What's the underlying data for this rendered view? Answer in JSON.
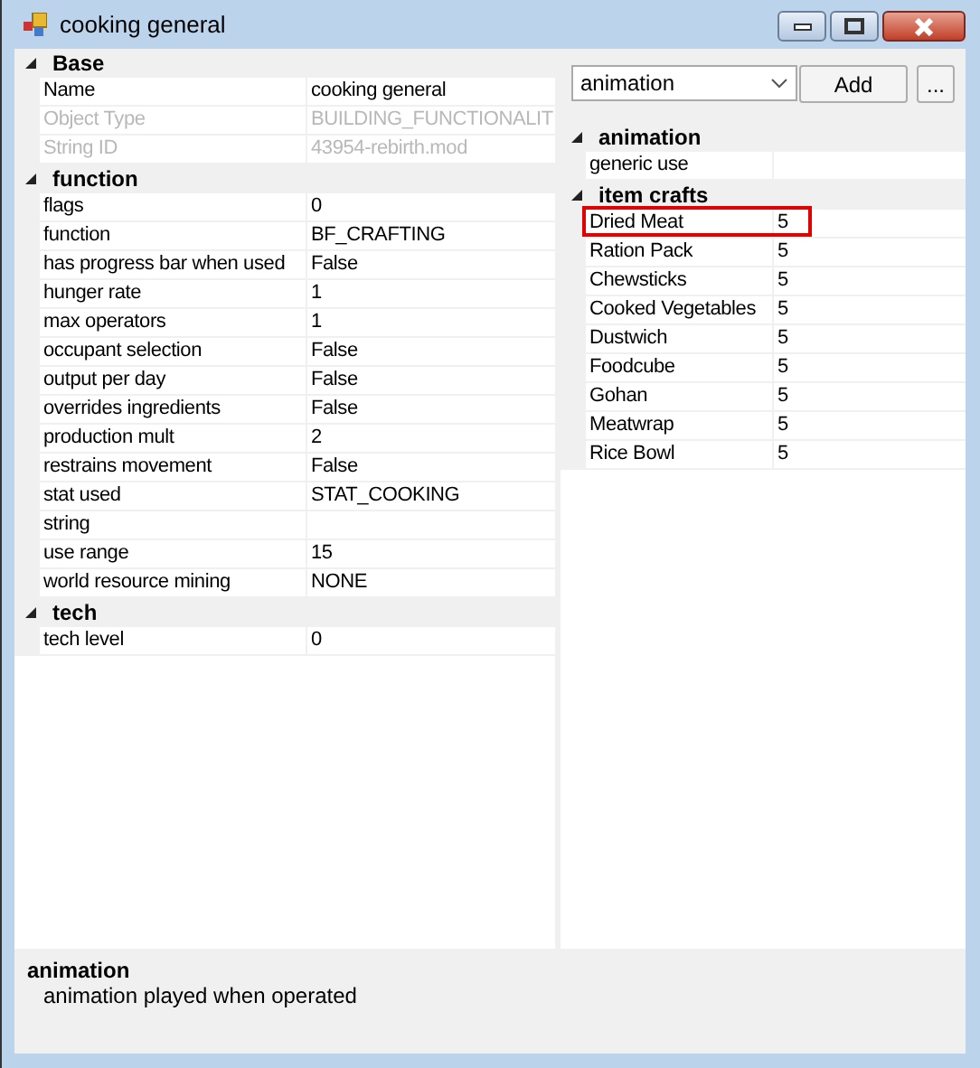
{
  "window": {
    "title": "cooking general"
  },
  "properties": [
    {
      "category": "Base",
      "expanded": true,
      "rows": [
        {
          "name": "Name",
          "value": "cooking general",
          "disabled": false
        },
        {
          "name": "Object Type",
          "value": "BUILDING_FUNCTIONALIT",
          "disabled": true
        },
        {
          "name": "String ID",
          "value": "43954-rebirth.mod",
          "disabled": true
        }
      ]
    },
    {
      "category": "function",
      "expanded": true,
      "rows": [
        {
          "name": "flags",
          "value": "0",
          "disabled": false
        },
        {
          "name": "function",
          "value": "BF_CRAFTING",
          "disabled": false
        },
        {
          "name": "has progress bar when used",
          "value": "False",
          "disabled": false
        },
        {
          "name": "hunger rate",
          "value": "1",
          "disabled": false
        },
        {
          "name": "max operators",
          "value": "1",
          "disabled": false
        },
        {
          "name": "occupant selection",
          "value": "False",
          "disabled": false
        },
        {
          "name": "output per day",
          "value": "False",
          "disabled": false
        },
        {
          "name": "overrides ingredients",
          "value": "False",
          "disabled": false
        },
        {
          "name": "production mult",
          "value": "2",
          "disabled": false
        },
        {
          "name": "restrains movement",
          "value": "False",
          "disabled": false
        },
        {
          "name": "stat used",
          "value": "STAT_COOKING",
          "disabled": false
        },
        {
          "name": "string",
          "disabled": false
        },
        {
          "name": "use range",
          "value": "15",
          "disabled": false
        },
        {
          "name": "world resource mining",
          "value": "NONE",
          "disabled": false
        }
      ]
    },
    {
      "category": "tech",
      "expanded": true,
      "rows": [
        {
          "name": "tech level",
          "value": "0",
          "disabled": false
        }
      ]
    }
  ],
  "toolbar": {
    "combo_value": "animation",
    "add_button": "Add",
    "more_button": "..."
  },
  "references": [
    {
      "category": "animation",
      "expanded": true,
      "rows": [
        {
          "name": "generic use",
          "highlighted": false
        }
      ]
    },
    {
      "category": "item crafts",
      "expanded": true,
      "rows": [
        {
          "name": "Dried Meat",
          "value": "5",
          "highlighted": true
        },
        {
          "name": "Ration Pack",
          "value": "5",
          "highlighted": false
        },
        {
          "name": "Chewsticks",
          "value": "5",
          "highlighted": false
        },
        {
          "name": "Cooked Vegetables",
          "value": "5",
          "highlighted": false
        },
        {
          "name": "Dustwich",
          "value": "5",
          "highlighted": false
        },
        {
          "name": "Foodcube",
          "value": "5",
          "highlighted": false
        },
        {
          "name": "Gohan",
          "value": "5",
          "highlighted": false
        },
        {
          "name": "Meatwrap",
          "value": "5",
          "highlighted": false
        },
        {
          "name": "Rice Bowl",
          "value": "5",
          "highlighted": false
        }
      ]
    }
  ],
  "description": {
    "title": "animation",
    "text": "animation played when operated"
  }
}
